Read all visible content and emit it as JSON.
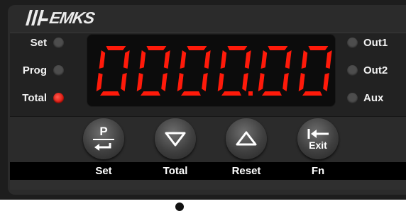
{
  "brand": {
    "logo_text": "EMKS"
  },
  "indicators_left": [
    {
      "label": "Set",
      "state": "off"
    },
    {
      "label": "Prog",
      "state": "off"
    },
    {
      "label": "Total",
      "state": "on"
    }
  ],
  "indicators_right": [
    {
      "label": "Out1",
      "state": "off"
    },
    {
      "label": "Out2",
      "state": "off"
    },
    {
      "label": "Aux",
      "state": "off"
    }
  ],
  "display": {
    "value": "0000.00",
    "digits": [
      "0",
      "0",
      "0",
      "0",
      "0",
      "0"
    ],
    "decimal_after_digit": 4,
    "color": "#ff1a0a"
  },
  "keys": [
    {
      "name": "p-enter-key",
      "glyph_top": "P",
      "glyph": "enter-arrow",
      "label": "Set"
    },
    {
      "name": "down-key",
      "glyph": "down-triangle",
      "label": "Total"
    },
    {
      "name": "up-key",
      "glyph": "up-triangle",
      "label": "Reset"
    },
    {
      "name": "exit-key",
      "glyph": "back-to-start-arrow",
      "glyph_bottom": "Exit",
      "label": "Fn"
    }
  ],
  "colors": {
    "led_on": "#e01b12",
    "led_off": "#4d4d4d",
    "segment_on": "#ff1a0a"
  }
}
